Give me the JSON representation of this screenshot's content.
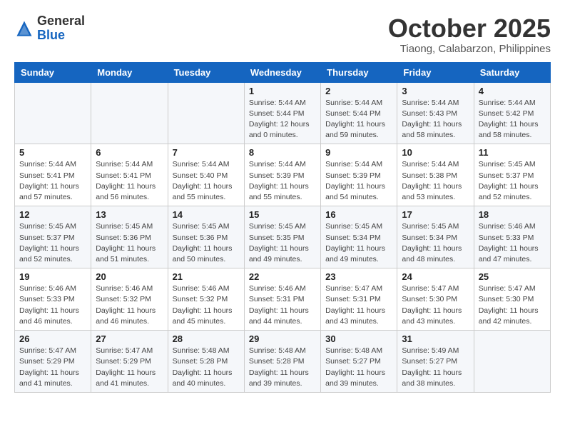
{
  "header": {
    "logo_general": "General",
    "logo_blue": "Blue",
    "month": "October 2025",
    "location": "Tiaong, Calabarzon, Philippines"
  },
  "weekdays": [
    "Sunday",
    "Monday",
    "Tuesday",
    "Wednesday",
    "Thursday",
    "Friday",
    "Saturday"
  ],
  "weeks": [
    [
      {
        "day": "",
        "info": ""
      },
      {
        "day": "",
        "info": ""
      },
      {
        "day": "",
        "info": ""
      },
      {
        "day": "1",
        "info": "Sunrise: 5:44 AM\nSunset: 5:44 PM\nDaylight: 12 hours\nand 0 minutes."
      },
      {
        "day": "2",
        "info": "Sunrise: 5:44 AM\nSunset: 5:44 PM\nDaylight: 11 hours\nand 59 minutes."
      },
      {
        "day": "3",
        "info": "Sunrise: 5:44 AM\nSunset: 5:43 PM\nDaylight: 11 hours\nand 58 minutes."
      },
      {
        "day": "4",
        "info": "Sunrise: 5:44 AM\nSunset: 5:42 PM\nDaylight: 11 hours\nand 58 minutes."
      }
    ],
    [
      {
        "day": "5",
        "info": "Sunrise: 5:44 AM\nSunset: 5:41 PM\nDaylight: 11 hours\nand 57 minutes."
      },
      {
        "day": "6",
        "info": "Sunrise: 5:44 AM\nSunset: 5:41 PM\nDaylight: 11 hours\nand 56 minutes."
      },
      {
        "day": "7",
        "info": "Sunrise: 5:44 AM\nSunset: 5:40 PM\nDaylight: 11 hours\nand 55 minutes."
      },
      {
        "day": "8",
        "info": "Sunrise: 5:44 AM\nSunset: 5:39 PM\nDaylight: 11 hours\nand 55 minutes."
      },
      {
        "day": "9",
        "info": "Sunrise: 5:44 AM\nSunset: 5:39 PM\nDaylight: 11 hours\nand 54 minutes."
      },
      {
        "day": "10",
        "info": "Sunrise: 5:44 AM\nSunset: 5:38 PM\nDaylight: 11 hours\nand 53 minutes."
      },
      {
        "day": "11",
        "info": "Sunrise: 5:45 AM\nSunset: 5:37 PM\nDaylight: 11 hours\nand 52 minutes."
      }
    ],
    [
      {
        "day": "12",
        "info": "Sunrise: 5:45 AM\nSunset: 5:37 PM\nDaylight: 11 hours\nand 52 minutes."
      },
      {
        "day": "13",
        "info": "Sunrise: 5:45 AM\nSunset: 5:36 PM\nDaylight: 11 hours\nand 51 minutes."
      },
      {
        "day": "14",
        "info": "Sunrise: 5:45 AM\nSunset: 5:36 PM\nDaylight: 11 hours\nand 50 minutes."
      },
      {
        "day": "15",
        "info": "Sunrise: 5:45 AM\nSunset: 5:35 PM\nDaylight: 11 hours\nand 49 minutes."
      },
      {
        "day": "16",
        "info": "Sunrise: 5:45 AM\nSunset: 5:34 PM\nDaylight: 11 hours\nand 49 minutes."
      },
      {
        "day": "17",
        "info": "Sunrise: 5:45 AM\nSunset: 5:34 PM\nDaylight: 11 hours\nand 48 minutes."
      },
      {
        "day": "18",
        "info": "Sunrise: 5:46 AM\nSunset: 5:33 PM\nDaylight: 11 hours\nand 47 minutes."
      }
    ],
    [
      {
        "day": "19",
        "info": "Sunrise: 5:46 AM\nSunset: 5:33 PM\nDaylight: 11 hours\nand 46 minutes."
      },
      {
        "day": "20",
        "info": "Sunrise: 5:46 AM\nSunset: 5:32 PM\nDaylight: 11 hours\nand 46 minutes."
      },
      {
        "day": "21",
        "info": "Sunrise: 5:46 AM\nSunset: 5:32 PM\nDaylight: 11 hours\nand 45 minutes."
      },
      {
        "day": "22",
        "info": "Sunrise: 5:46 AM\nSunset: 5:31 PM\nDaylight: 11 hours\nand 44 minutes."
      },
      {
        "day": "23",
        "info": "Sunrise: 5:47 AM\nSunset: 5:31 PM\nDaylight: 11 hours\nand 43 minutes."
      },
      {
        "day": "24",
        "info": "Sunrise: 5:47 AM\nSunset: 5:30 PM\nDaylight: 11 hours\nand 43 minutes."
      },
      {
        "day": "25",
        "info": "Sunrise: 5:47 AM\nSunset: 5:30 PM\nDaylight: 11 hours\nand 42 minutes."
      }
    ],
    [
      {
        "day": "26",
        "info": "Sunrise: 5:47 AM\nSunset: 5:29 PM\nDaylight: 11 hours\nand 41 minutes."
      },
      {
        "day": "27",
        "info": "Sunrise: 5:47 AM\nSunset: 5:29 PM\nDaylight: 11 hours\nand 41 minutes."
      },
      {
        "day": "28",
        "info": "Sunrise: 5:48 AM\nSunset: 5:28 PM\nDaylight: 11 hours\nand 40 minutes."
      },
      {
        "day": "29",
        "info": "Sunrise: 5:48 AM\nSunset: 5:28 PM\nDaylight: 11 hours\nand 39 minutes."
      },
      {
        "day": "30",
        "info": "Sunrise: 5:48 AM\nSunset: 5:27 PM\nDaylight: 11 hours\nand 39 minutes."
      },
      {
        "day": "31",
        "info": "Sunrise: 5:49 AM\nSunset: 5:27 PM\nDaylight: 11 hours\nand 38 minutes."
      },
      {
        "day": "",
        "info": ""
      }
    ]
  ]
}
